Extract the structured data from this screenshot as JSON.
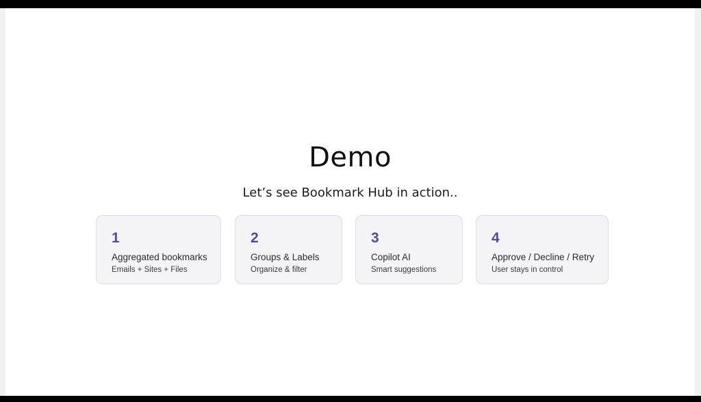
{
  "slide": {
    "title": "Demo",
    "subtitle": "Let’s see Bookmark Hub in action.."
  },
  "cards": [
    {
      "number": "1",
      "title": "Aggregated bookmarks",
      "subtitle": "Emails + Sites + Files"
    },
    {
      "number": "2",
      "title": "Groups & Labels",
      "subtitle": "Organize & filter"
    },
    {
      "number": "3",
      "title": "Copilot AI",
      "subtitle": "Smart suggestions"
    },
    {
      "number": "4",
      "title": "Approve / Decline / Retry",
      "subtitle": "User stays in control"
    }
  ],
  "colors": {
    "accent": "#4b4e9c",
    "card_background": "#f4f4f7",
    "card_border": "#dcdce2",
    "letterbox": "#000000"
  }
}
